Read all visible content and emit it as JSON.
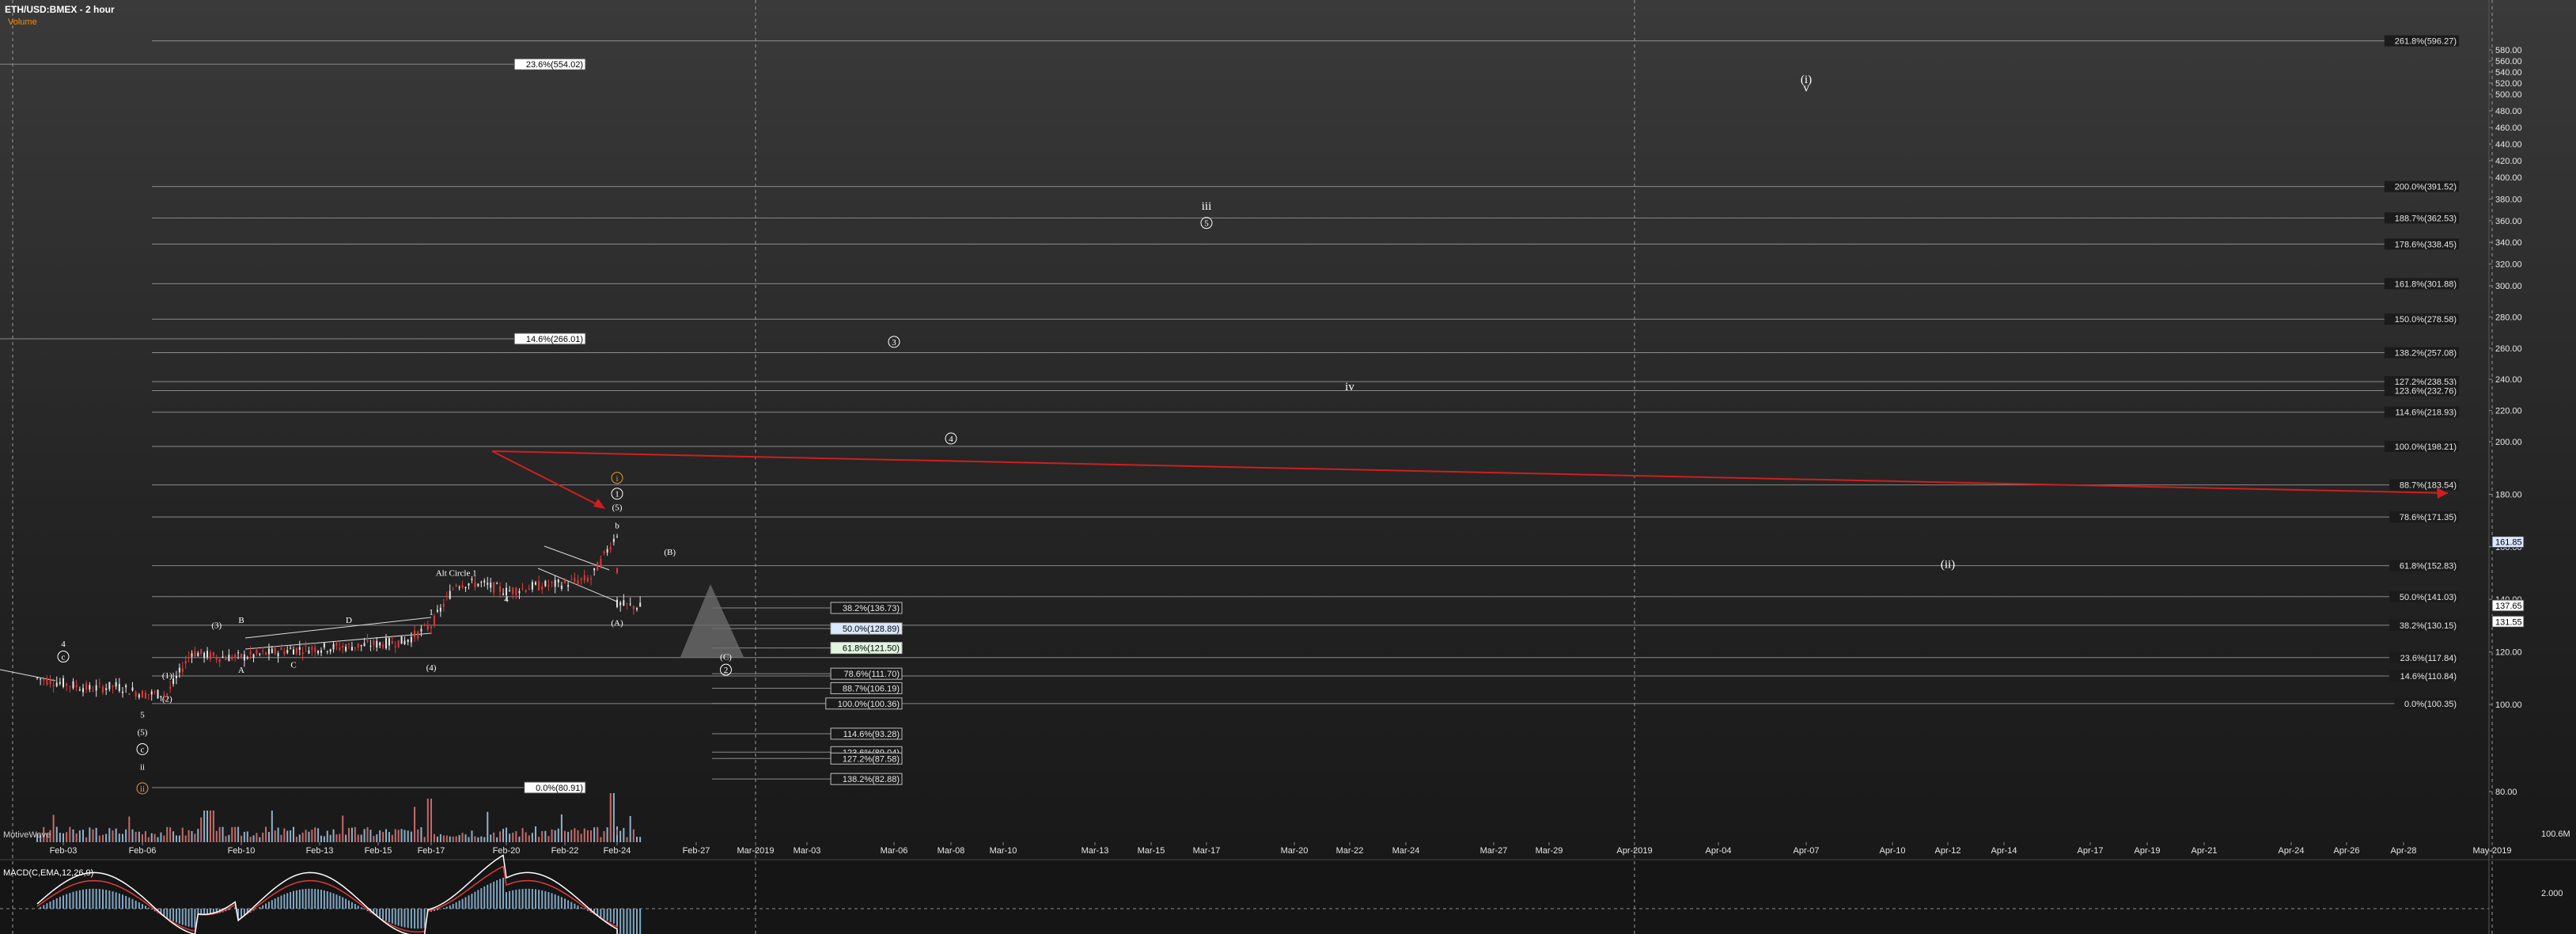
{
  "header": {
    "symbol_title": "ETH/USD:BMEX - 2 hour",
    "volume_label": "Volume",
    "volume_label_color": "#ff8c00"
  },
  "panels": {
    "motivewave_label": "MotiveWave",
    "macd_label": "MACD(C,EMA,12,26,9)",
    "volume_axis_label": "100.6M",
    "macd_axis_label": "2.000"
  },
  "colors": {
    "background": "#1b1b1b",
    "fib_line": "#8a8a8a",
    "trend_arrow": "#d01e1e",
    "price_up": "#e6e6e6",
    "price_down": "#e03a3a",
    "volume_up": "#8fb0c8",
    "volume_down": "#c76a6a",
    "macd_line": "#ffffff",
    "signal_line": "#e03a3a",
    "macd_hist": "#7fa8c6",
    "support_label_bg": "#dff7df",
    "blue_label_bg": "#dbe8ff"
  },
  "chart_data": {
    "type": "candlestick",
    "title": "ETH/USD:BMEX - 2 hour",
    "y_axis": {
      "min": 60,
      "max": 604,
      "ticks": [
        80,
        100,
        120,
        140,
        160,
        180,
        200,
        220,
        240,
        260,
        280,
        300,
        320,
        340,
        360,
        380,
        400,
        420,
        440,
        460,
        480,
        500,
        520,
        540,
        560,
        580
      ],
      "price_tags": [
        "161.85",
        "137.65",
        "131.55"
      ]
    },
    "x_axis": {
      "date_labels": [
        "Feb-03",
        "Feb-06",
        "Feb-10",
        "Feb-13",
        "Feb-15",
        "Feb-17",
        "Feb-20",
        "Feb-22",
        "Feb-24",
        "Feb-27",
        "Mar-2019",
        "Mar-03",
        "Mar-06",
        "Mar-08",
        "Mar-10",
        "Mar-13",
        "Mar-15",
        "Mar-17",
        "Mar-20",
        "Mar-22",
        "Mar-24",
        "Mar-27",
        "Mar-29",
        "Apr-2019",
        "Apr-04",
        "Apr-07",
        "Apr-10",
        "Apr-12",
        "Apr-14",
        "Apr-17",
        "Apr-19",
        "Apr-21",
        "Apr-24",
        "Apr-26",
        "Apr-28",
        "May-2019"
      ],
      "month_separators": [
        "Mar-2019",
        "Apr-2019",
        "May-2019"
      ]
    },
    "price_series": {
      "name": "ETH/USD",
      "points": [
        [
          "Feb-02",
          110
        ],
        [
          "Feb-03",
          108
        ],
        [
          "Feb-04",
          106
        ],
        [
          "Feb-05",
          107
        ],
        [
          "Feb-06",
          104
        ],
        [
          "Feb-07",
          104
        ],
        [
          "Feb-08",
          120
        ],
        [
          "Feb-09",
          118
        ],
        [
          "Feb-10",
          118
        ],
        [
          "Feb-12",
          121
        ],
        [
          "Feb-14",
          122
        ],
        [
          "Feb-16",
          124
        ],
        [
          "Feb-17",
          130
        ],
        [
          "Feb-18",
          146
        ],
        [
          "Feb-19",
          146
        ],
        [
          "Feb-20",
          143
        ],
        [
          "Feb-21",
          145
        ],
        [
          "Feb-22",
          146
        ],
        [
          "Feb-23",
          148
        ],
        [
          "Feb-24",
          165
        ],
        [
          "Feb-24",
          138
        ],
        [
          "Feb-25",
          137
        ]
      ]
    },
    "volume_series": {
      "name": "Volume",
      "max_shown": "100.6M"
    },
    "macd": {
      "name": "MACD(C,EMA,12,26,9)",
      "params": [
        12,
        26,
        9
      ]
    },
    "fib_levels_right": [
      {
        "label": "261.8%(596.27)",
        "value": 596.27
      },
      {
        "label": "200.0%(391.52)",
        "value": 391.52
      },
      {
        "label": "188.7%(362.53)",
        "value": 362.53
      },
      {
        "label": "178.6%(338.45)",
        "value": 338.45
      },
      {
        "label": "161.8%(301.88)",
        "value": 301.88
      },
      {
        "label": "150.0%(278.58)",
        "value": 278.58
      },
      {
        "label": "138.2%(257.08)",
        "value": 257.08
      },
      {
        "label": "127.2%(238.53)",
        "value": 238.53
      },
      {
        "label": "123.6%(232.76)",
        "value": 232.76
      },
      {
        "label": "114.6%(218.93)",
        "value": 218.93
      },
      {
        "label": "100.0%(198.21)",
        "value": 198.21
      },
      {
        "label": "88.7%(183.54)",
        "value": 183.54
      },
      {
        "label": "78.6%(171.35)",
        "value": 171.35
      },
      {
        "label": "61.8%(152.83)",
        "value": 152.83
      },
      {
        "label": "50.0%(141.03)",
        "value": 141.03
      },
      {
        "label": "38.2%(130.15)",
        "value": 130.15
      },
      {
        "label": "23.6%(117.84)",
        "value": 117.84
      },
      {
        "label": "14.6%(110.84)",
        "value": 110.84
      },
      {
        "label": "0.0%(100.35)",
        "value": 100.35
      }
    ],
    "fib_levels_left": [
      {
        "label": "23.6%(554.02)",
        "value": 554.02
      },
      {
        "label": "14.6%(266.01)",
        "value": 266.01
      },
      {
        "label": "0.0%(80.91)",
        "value": 80.91
      }
    ],
    "fib_levels_retrace": [
      {
        "label": "38.2%(136.73)",
        "value": 136.73,
        "style": "plain"
      },
      {
        "label": "50.0%(128.89)",
        "value": 128.89,
        "style": "blue"
      },
      {
        "label": "61.8%(121.50)",
        "value": 121.5,
        "style": "green"
      },
      {
        "label": "78.6%(111.70)",
        "value": 111.7,
        "style": "plain"
      },
      {
        "label": "88.7%(106.19)",
        "value": 106.19,
        "style": "plain"
      },
      {
        "label": "100.0%(100.36)",
        "value": 100.36,
        "style": "plain"
      },
      {
        "label": "114.6%(93.28)",
        "value": 93.28,
        "style": "plain"
      },
      {
        "label": "123.6%(89.04)",
        "value": 89.04,
        "style": "plain"
      },
      {
        "label": "127.2%(87.58)",
        "value": 87.58,
        "style": "plain"
      },
      {
        "label": "138.2%(82.88)",
        "value": 82.88,
        "style": "plain"
      }
    ],
    "wave_labels": [
      {
        "text": "(i)",
        "date": "Apr-07",
        "price": 520
      },
      {
        "text": "v",
        "date": "Apr-07",
        "price": 505
      },
      {
        "text": "iii",
        "date": "Mar-17",
        "price": 370
      },
      {
        "text": "5",
        "date": "Mar-17",
        "price": 355,
        "circled": true
      },
      {
        "text": "3",
        "date": "Mar-06",
        "price": 262,
        "circled": true
      },
      {
        "text": "iv",
        "date": "Mar-22",
        "price": 233
      },
      {
        "text": "4",
        "date": "Mar-08",
        "price": 200,
        "circled": true
      },
      {
        "text": "(ii)",
        "date": "Apr-12",
        "price": 152
      },
      {
        "text": "(B)",
        "date": "Feb-26",
        "price": 157
      },
      {
        "text": "(A)",
        "date": "Feb-24",
        "price": 130
      },
      {
        "text": "(C)",
        "date": "Feb-28",
        "price": 117
      },
      {
        "text": "2",
        "date": "Feb-28",
        "price": 112,
        "circled": true
      },
      {
        "text": "b",
        "date": "Feb-24",
        "price": 167
      },
      {
        "text": "(5)",
        "date": "Feb-24",
        "price": 174
      },
      {
        "text": "1",
        "date": "Feb-24",
        "price": 179,
        "circled": true
      },
      {
        "text": "i",
        "date": "Feb-24",
        "price": 185,
        "circled": true,
        "color": "#e0a030"
      },
      {
        "text": "Alt Circle 1",
        "date": "Feb-18",
        "price": 149
      },
      {
        "text": "4",
        "date": "Feb-20",
        "price": 139
      },
      {
        "text": "1",
        "date": "Feb-17",
        "price": 134
      },
      {
        "text": "(4)",
        "date": "Feb-17",
        "price": 113
      },
      {
        "text": "(3)",
        "date": "Feb-09",
        "price": 129
      },
      {
        "text": "B",
        "date": "Feb-10",
        "price": 131
      },
      {
        "text": "D",
        "date": "Feb-14",
        "price": 131
      },
      {
        "text": "A",
        "date": "Feb-10",
        "price": 112
      },
      {
        "text": "C",
        "date": "Feb-12",
        "price": 114
      },
      {
        "text": "(1)",
        "date": "Feb-07",
        "price": 110
      },
      {
        "text": "(2)",
        "date": "Feb-07",
        "price": 101
      },
      {
        "text": "4",
        "date": "Feb-03",
        "price": 122
      },
      {
        "text": "c",
        "date": "Feb-03",
        "price": 117,
        "circled": true
      },
      {
        "text": "5",
        "date": "Feb-06",
        "price": 97
      },
      {
        "text": "(5)",
        "date": "Feb-06",
        "price": 93
      },
      {
        "text": "c",
        "date": "Feb-06",
        "price": 89,
        "circled": true
      },
      {
        "text": "ii",
        "date": "Feb-06",
        "price": 85
      },
      {
        "text": "ii",
        "date": "Feb-06",
        "price": 80,
        "circled": true,
        "color": "#e0a030"
      }
    ]
  }
}
